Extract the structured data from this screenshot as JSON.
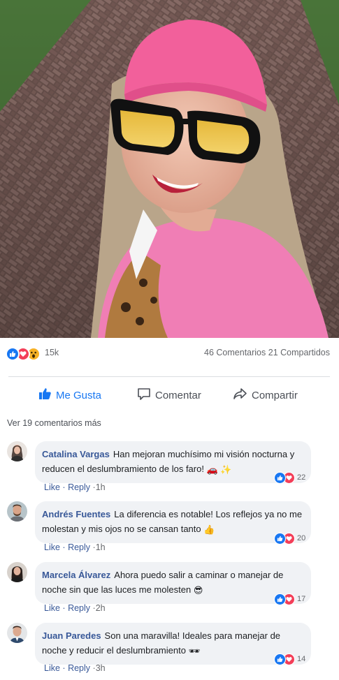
{
  "post": {
    "photo_icon": "selfie-photo",
    "reaction_count": "15k",
    "comments_count": "46 Comentarios",
    "shares_count": "21 Compartidos"
  },
  "actions": {
    "like": "Me Gusta",
    "comment": "Comentar",
    "share": "Compartir"
  },
  "more_comments": "Ver 19 comentarios más",
  "link_like": "Like",
  "link_reply": "Reply",
  "separator": "·",
  "comments": [
    {
      "author": "Catalina Vargas",
      "text": "Han mejoran muchísimo mi visión nocturna y reducen el deslumbramiento de los faro!",
      "emoji": "🚗 ✨",
      "reactions": "22",
      "time": "1h"
    },
    {
      "author": "Andrés Fuentes",
      "text": "La diferencia es notable! Los reflejos ya no me molestan y mis ojos no se cansan tanto",
      "emoji": "👍",
      "reactions": "20",
      "time": "1h"
    },
    {
      "author": "Marcela Álvarez",
      "text": "Ahora puedo salir a caminar o manejar de noche sin que las luces me molesten",
      "emoji": "😎",
      "reactions": "17",
      "time": "2h"
    },
    {
      "author": "Juan Paredes",
      "text": "Son una maravilla! Ideales para manejar de noche y reducir el deslumbramiento",
      "emoji": "🕶",
      "reactions": "14",
      "time": "3h"
    }
  ],
  "colors": {
    "accent": "#1877f2",
    "love": "#f33e58",
    "link": "#385898",
    "bubble": "#f0f2f5"
  }
}
